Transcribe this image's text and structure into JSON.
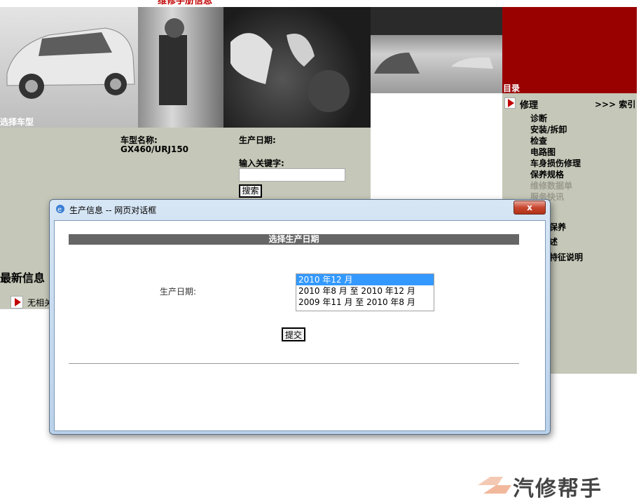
{
  "top_partial_text": "维修手册信息",
  "photos": {
    "car_label": "选择车型"
  },
  "vehicle": {
    "name_label": "车型名称:",
    "name_value": "GX460/URJ150",
    "date_label": "生产日期:",
    "keyword_label": "输入关键字:",
    "keyword_value": "",
    "search_button": "搜索"
  },
  "news": {
    "title": "最新信息",
    "item_partial": "无相关"
  },
  "sidebar": {
    "title": "目录",
    "section": "修理",
    "index_link": ">>> 索引",
    "items": [
      "诊断",
      "安装/拆卸",
      "检查",
      "电路图",
      "车身损伤修理",
      "保养规格",
      "维修数据单",
      "服务快讯"
    ],
    "partial_items": [
      "保养",
      "述",
      "特征说明"
    ]
  },
  "dialog": {
    "title": "生产信息 -- 网页对话框",
    "header": "选择生产日期",
    "field_label": "生产日期:",
    "options": [
      "2010 年12 月",
      "2010 年8 月  至  2010 年12 月",
      "2009 年11 月  至  2010 年8 月"
    ],
    "selected_index": 0,
    "submit_label": "提交",
    "close_label": "x"
  },
  "watermark": "汽修帮手",
  "colors": {
    "accent_red": "#990000",
    "panel_olive": "#c5c7b8",
    "selection_blue": "#3399ff"
  }
}
